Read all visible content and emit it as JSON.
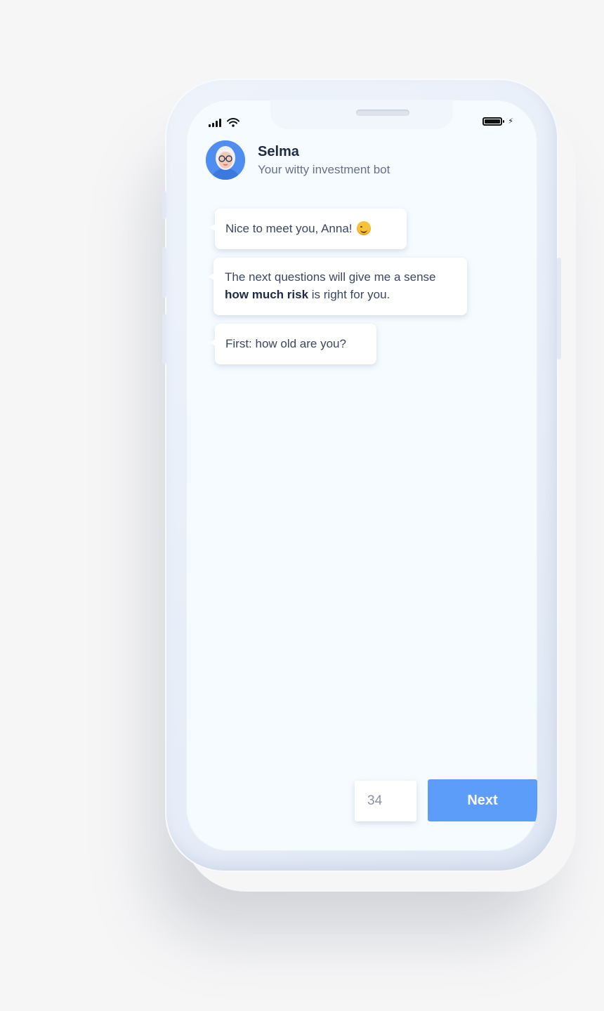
{
  "status_bar": {
    "signal_icon": "cellular-signal-icon",
    "wifi_icon": "wifi-icon",
    "battery_icon": "battery-full-icon",
    "charging_icon": "charging-bolt-icon"
  },
  "header": {
    "bot_name": "Selma",
    "bot_subtitle": "Your witty investment bot",
    "avatar_icon": "bot-avatar"
  },
  "messages": [
    {
      "text": "Nice to meet you, Anna!",
      "emoji": "smiling-face-emoji"
    },
    {
      "text_before": "The next questions will give me a sense ",
      "text_bold": "how much risk",
      "text_after": " is right for you."
    },
    {
      "text": "First: how old are you?"
    }
  ],
  "answer": {
    "value": "34",
    "next_label": "Next"
  },
  "colors": {
    "accent": "#5b9df8",
    "text_dark": "#1f2a44",
    "text_muted": "#66718a",
    "screen_bg": "#f5fbff"
  }
}
